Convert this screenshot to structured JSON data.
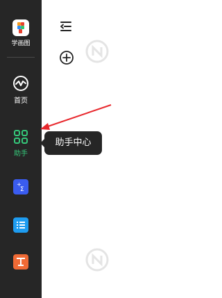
{
  "sidebar": {
    "brand_label": "学画图",
    "items": [
      {
        "label": "首页",
        "icon": "pulse-icon"
      },
      {
        "label": "助手",
        "icon": "grid-icon",
        "active": true
      }
    ],
    "apps": [
      {
        "icon": "formula-icon",
        "color": "#3a5cf0"
      },
      {
        "icon": "list-icon",
        "color": "#1e9cf0"
      },
      {
        "icon": "text-icon",
        "color": "#f06a35"
      }
    ]
  },
  "tooltip": {
    "text": "助手中心"
  },
  "colors": {
    "sidebar_bg": "#262626",
    "active_green": "#35c87a",
    "annotation_red": "#e8282d"
  }
}
